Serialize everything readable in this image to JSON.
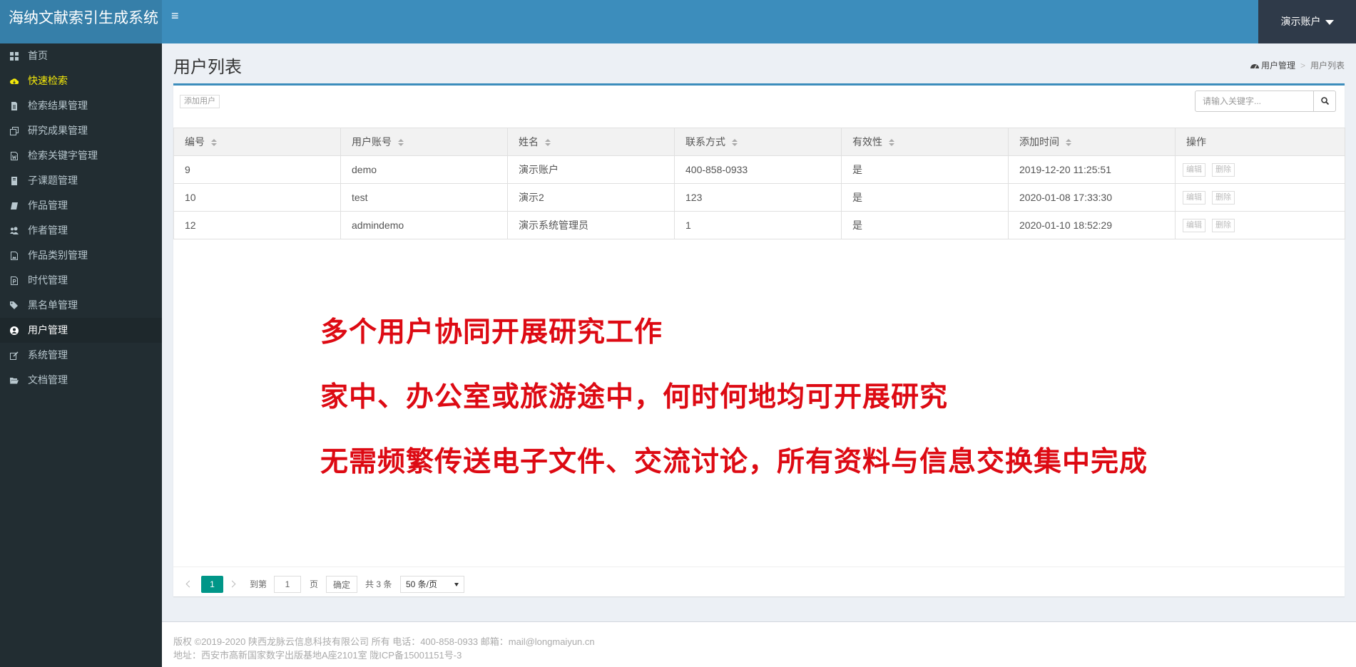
{
  "app": {
    "title": "海纳文献索引生成系统",
    "user_menu": "演示账户"
  },
  "sidebar": {
    "items": [
      {
        "label": "首页",
        "icon": "dashboard-icon"
      },
      {
        "label": "快速检索",
        "icon": "cloud-download-icon"
      },
      {
        "label": "检索结果管理",
        "icon": "file-text-icon"
      },
      {
        "label": "研究成果管理",
        "icon": "clone-icon"
      },
      {
        "label": "检索关键字管理",
        "icon": "file-word-icon"
      },
      {
        "label": "子课题管理",
        "icon": "book-bookmark-icon"
      },
      {
        "label": "作品管理",
        "icon": "book-icon"
      },
      {
        "label": "作者管理",
        "icon": "users-icon"
      },
      {
        "label": "作品类别管理",
        "icon": "file-image-icon"
      },
      {
        "label": "时代管理",
        "icon": "file-powerpoint-icon"
      },
      {
        "label": "黑名单管理",
        "icon": "tags-icon"
      },
      {
        "label": "用户管理",
        "icon": "user-circle-icon"
      },
      {
        "label": "系统管理",
        "icon": "edit-icon"
      },
      {
        "label": "文档管理",
        "icon": "folder-open-icon"
      }
    ]
  },
  "page": {
    "title": "用户列表"
  },
  "breadcrumb": {
    "parent": "用户管理",
    "current": "用户列表"
  },
  "toolbar": {
    "add_label": "添加用户",
    "search_placeholder": "请输入关键字..."
  },
  "table": {
    "headers": [
      "编号",
      "用户账号",
      "姓名",
      "联系方式",
      "有效性",
      "添加时间",
      "操作"
    ],
    "rows": [
      {
        "id": "9",
        "account": "demo",
        "name": "演示账户",
        "contact": "400-858-0933",
        "valid": "是",
        "added": "2019-12-20 11:25:51"
      },
      {
        "id": "10",
        "account": "test",
        "name": "演示2",
        "contact": "123",
        "valid": "是",
        "added": "2020-01-08 17:33:30"
      },
      {
        "id": "12",
        "account": "admindemo",
        "name": "演示系统管理员",
        "contact": "1",
        "valid": "是",
        "added": "2020-01-10 18:52:29"
      }
    ],
    "edit_label": "编辑",
    "delete_label": "删除"
  },
  "overlay": {
    "lines": [
      "多个用户协同开展研究工作",
      "家中、办公室或旅游途中，何时何地均可开展研究",
      "无需频繁传送电子文件、交流讨论，所有资料与信息交换集中完成"
    ]
  },
  "pager": {
    "current": "1",
    "goto_label": "到第",
    "page_value": "1",
    "page_suffix": "页",
    "confirm": "确定",
    "total": "共 3 条",
    "page_size": "50 条/页"
  },
  "footer": {
    "line1": "版权 ©2019-2020 陕西龙脉云信息科技有限公司 所有   电话：400-858-0933  邮箱：mail@longmaiyun.cn",
    "line2": "地址：西安市高新国家数字出版基地A座2101室   陇ICP备15001151号-3"
  },
  "colors": {
    "header": "#3c8dbc",
    "logo_bg": "#367fa9",
    "sidebar": "#222d32",
    "highlight": "#f4e90a",
    "overlay_text": "#dd0a13",
    "pager_active": "#009688"
  }
}
